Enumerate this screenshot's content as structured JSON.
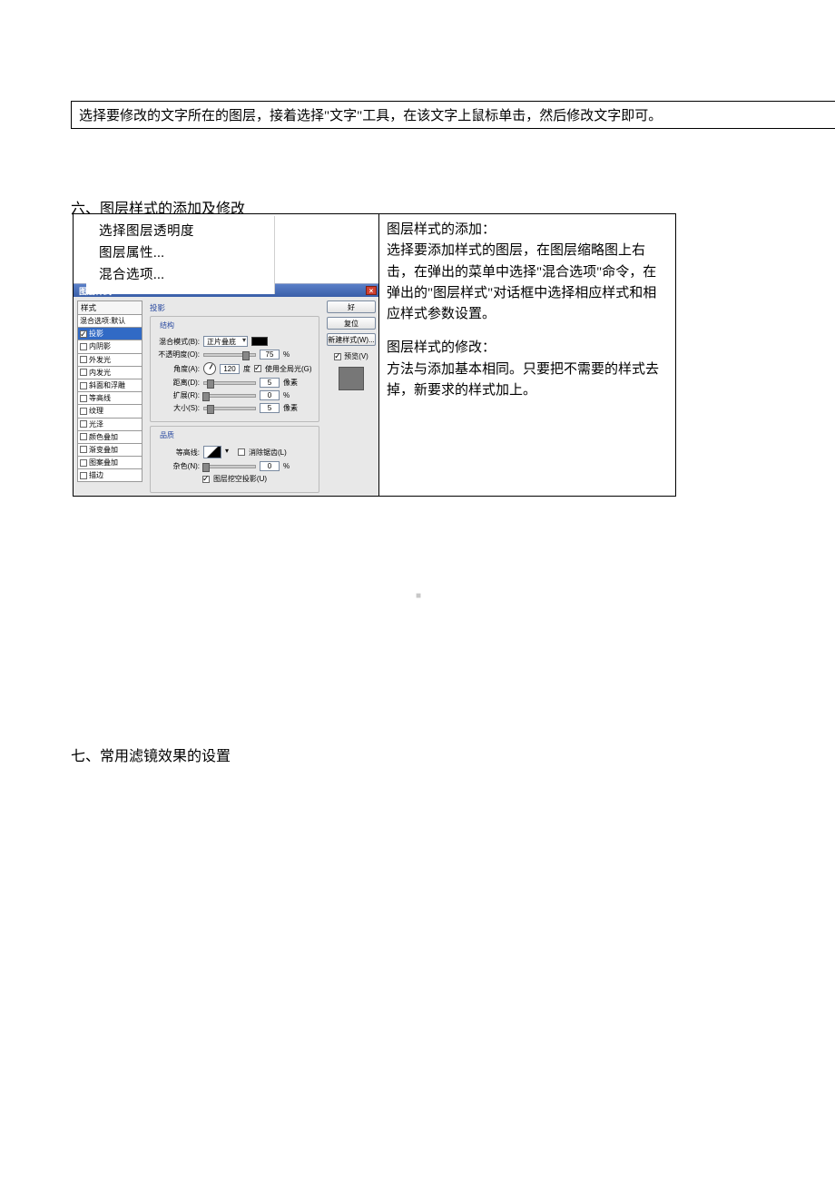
{
  "top_instruction": "选择要修改的文字所在的图层，接着选择\"文字\"工具，在该文字上鼠标单击，然后修改文字即可。",
  "section6_title": "六、图层样式的添加及修改",
  "section7_title": "七、常用滤镜效果的设置",
  "context_menu": {
    "item1": "选择图层透明度",
    "item2": "图层属性...",
    "item3": "混合选项..."
  },
  "explain": {
    "add_title": "图层样式的添加：",
    "add_p1": "选择要添加样式的图层，在图层缩略图上右击，在弹出的菜单中选择\"混合选项\"命令，在弹出的\"图层样式\"对话框中选择相应样式和相应样式参数设置。",
    "mod_title": "图层样式的修改：",
    "mod_p1": "方法与添加基本相同。只要把不需要的样式去掉，新要求的样式加上。"
  },
  "dialog": {
    "title": "图层样式",
    "styles_header": "样式",
    "styles": {
      "blend_default": "混合选项:默认",
      "drop_shadow": "投影",
      "inner_shadow": "内阴影",
      "outer_glow": "外发光",
      "inner_glow": "内发光",
      "bevel_emboss": "斜面和浮雕",
      "contour": "等高线",
      "texture": "纹理",
      "satin": "光泽",
      "color_overlay": "颜色叠加",
      "gradient_overlay": "渐变叠加",
      "pattern_overlay": "图案叠加",
      "stroke": "描边"
    },
    "center": {
      "section": "投影",
      "group_structure": "结构",
      "blend_mode_label": "混合模式(B):",
      "blend_mode_value": "正片叠底",
      "opacity_label": "不透明度(O):",
      "opacity_value": "75",
      "opacity_unit": "%",
      "angle_label": "角度(A):",
      "angle_value": "120",
      "angle_unit": "度",
      "global_light": "使用全局光(G)",
      "distance_label": "距离(D):",
      "distance_value": "5",
      "distance_unit": "像素",
      "spread_label": "扩展(R):",
      "spread_value": "0",
      "spread_unit": "%",
      "size_label": "大小(S):",
      "size_value": "5",
      "size_unit": "像素",
      "group_quality": "品质",
      "contour_label": "等高线:",
      "antialias": "消除锯齿(L)",
      "noise_label": "杂色(N):",
      "noise_value": "0",
      "noise_unit": "%",
      "knockout": "图层挖空投影(U)"
    },
    "buttons": {
      "ok": "好",
      "reset": "复位",
      "new_style": "新建样式(W)...",
      "preview": "预览(V)"
    }
  }
}
